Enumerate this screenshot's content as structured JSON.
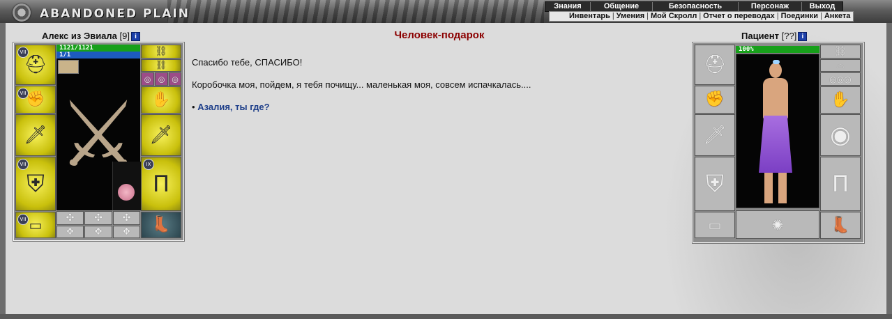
{
  "header": {
    "logo_text": "ABANDONED PLAIN",
    "menu_primary": [
      "Знания",
      "Общение",
      "Безопасность",
      "Персонаж",
      "Выход"
    ],
    "menu_secondary": [
      "Инвентарь",
      "Умения",
      "Мой Скролл",
      "Отчет о переводах",
      "Поединки",
      "Анкета"
    ]
  },
  "player": {
    "name": "Алекс из Эвиала",
    "level": "[9]",
    "hp": "1121/1121",
    "mp": "1/1",
    "hp_fraction": 1.0,
    "mp_fraction": 1.0,
    "colors": {
      "hp": "#17a01a",
      "mp": "#1d5bbf"
    }
  },
  "npc": {
    "name": "Пациент",
    "level": "[??]",
    "hp_percent": "100%",
    "hp_fraction": 1.0
  },
  "dialog": {
    "title": "Человек-подарок",
    "line1": "Спасибо тебе, СПАСИБО!",
    "line2": "Коробочка моя, пойдем, я тебя почищу... маленькая моя, совсем испачкалась....",
    "bullet": "•",
    "answer": "Азалия, ты где?"
  },
  "info_label": "i",
  "slot_ranks": {
    "helmet": "VII",
    "gloves": "VII",
    "armor": "VII",
    "belt": "VII",
    "pants": "IX"
  },
  "colors": {
    "title": "#8b0000",
    "link": "#1e3f8a",
    "slot_yellow": "#d8cf1a",
    "slot_empty": "#b9b9b9"
  }
}
